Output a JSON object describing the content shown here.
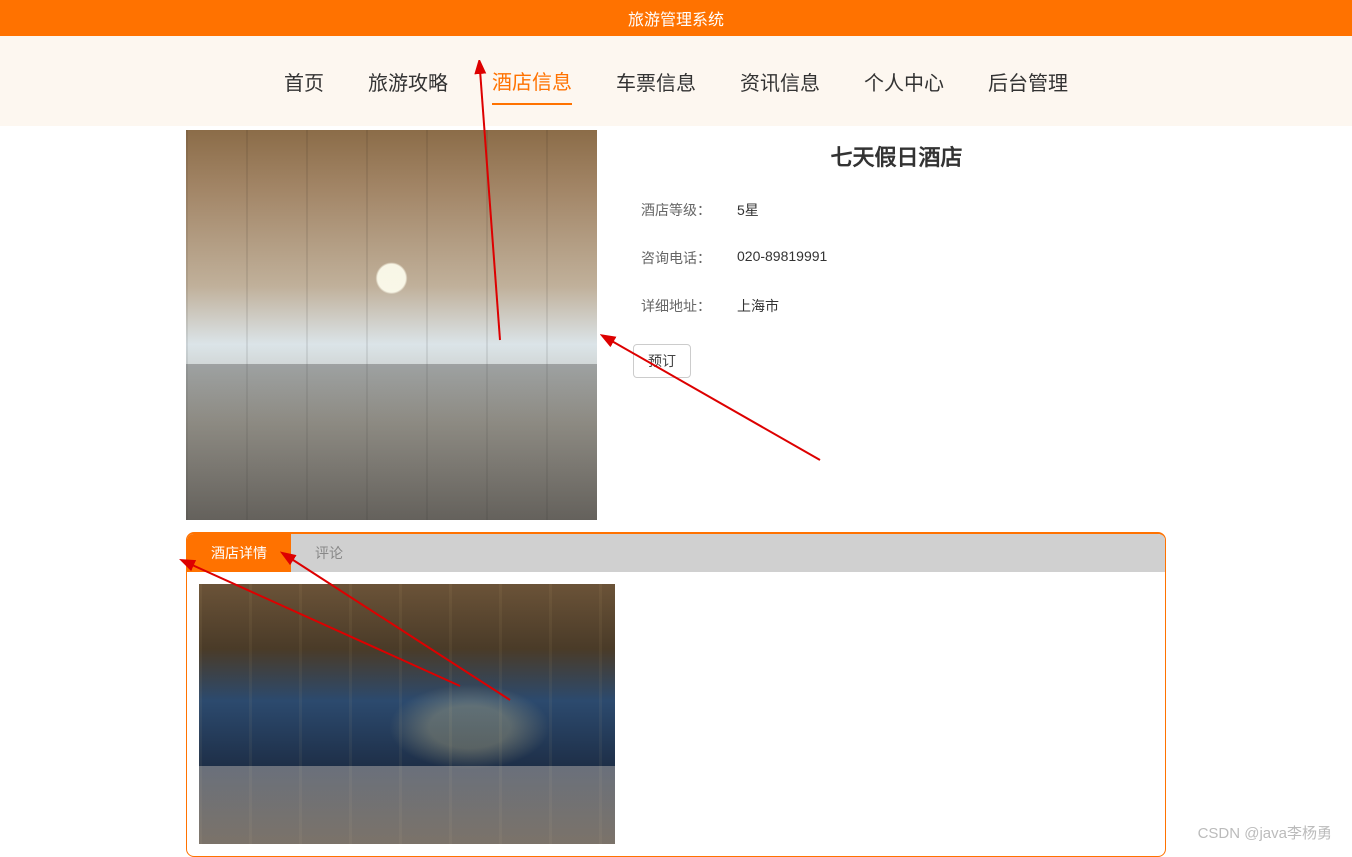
{
  "header": {
    "title": "旅游管理系统"
  },
  "nav": {
    "items": [
      {
        "label": "首页",
        "active": false
      },
      {
        "label": "旅游攻略",
        "active": false
      },
      {
        "label": "酒店信息",
        "active": true
      },
      {
        "label": "车票信息",
        "active": false
      },
      {
        "label": "资讯信息",
        "active": false
      },
      {
        "label": "个人中心",
        "active": false
      },
      {
        "label": "后台管理",
        "active": false
      }
    ]
  },
  "hotel": {
    "title": "七天假日酒店",
    "fields": {
      "grade_label": "酒店等级：",
      "grade_value": "5星",
      "phone_label": "咨询电话：",
      "phone_value": "020-89819991",
      "addr_label": "详细地址：",
      "addr_value": "上海市"
    },
    "book_label": "预订"
  },
  "tabs": {
    "items": [
      {
        "label": "酒店详情",
        "active": true
      },
      {
        "label": "评论",
        "active": false
      }
    ]
  },
  "watermark": "CSDN @java李杨勇"
}
